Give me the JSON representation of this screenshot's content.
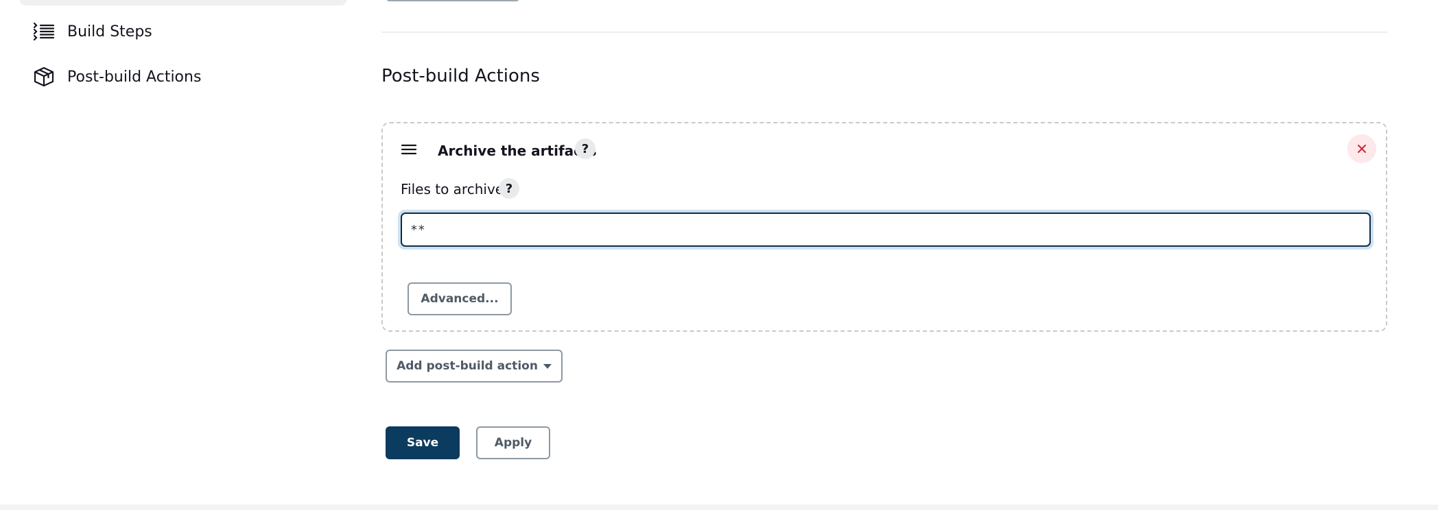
{
  "sidebar": {
    "items": [
      {
        "label": "Build Steps",
        "icon": "list-steps-icon"
      },
      {
        "label": "Post-build Actions",
        "icon": "package-icon"
      }
    ]
  },
  "main": {
    "section_title": "Post-build Actions",
    "archive_step": {
      "title": "Archive the artifacts",
      "help_label": "?",
      "files_label": "Files to archive",
      "files_value": "**",
      "advanced_label": "Advanced..."
    },
    "add_action_label": "Add post-build action",
    "save_label": "Save",
    "apply_label": "Apply"
  },
  "colors": {
    "primary": "#0b3b5e",
    "close_red": "#d0263a",
    "focus_ring": "#cfe1ef"
  }
}
